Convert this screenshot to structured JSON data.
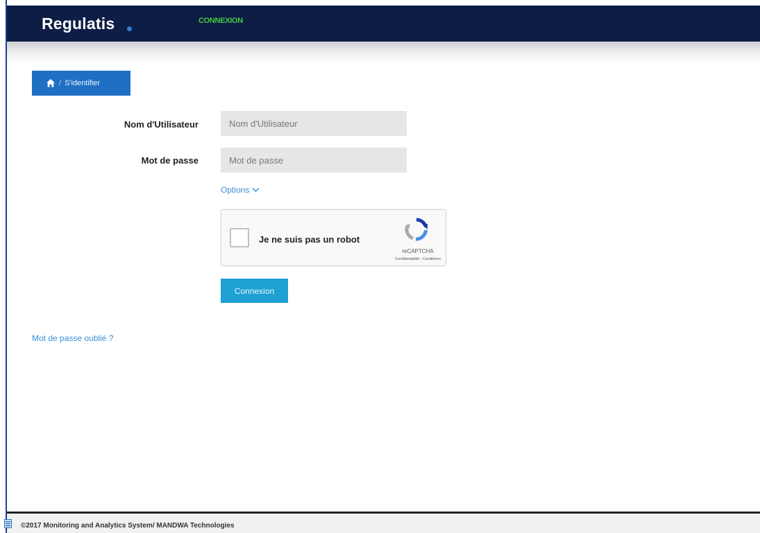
{
  "header": {
    "brand": "Regulatis",
    "nav_link": "CONNEXION",
    "colors": {
      "bar": "#0e1d45",
      "nav_link": "#3ecb3e"
    }
  },
  "breadcrumb": {
    "home_icon": "home-icon",
    "separator": "/",
    "current": "S'identifier"
  },
  "login_form": {
    "username": {
      "label": "Nom d'Utilisateur",
      "value": "",
      "placeholder": "Nom d'Utilisateur"
    },
    "password": {
      "label": "Mot de passe",
      "value": "",
      "placeholder": "Mot de passe"
    },
    "options_label": "Options",
    "captcha": {
      "checkbox_label": "Je ne suis pas un robot",
      "brand": "reCAPTCHA",
      "terms": "Confidentialité - Conditions",
      "icon": "recaptcha-icon"
    },
    "submit_label": "Connexion",
    "forgot_password": "Mot de passe oublié ?"
  },
  "footer": {
    "text": "©2017 Monitoring and Analytics System/ MANDWA Technologies"
  }
}
